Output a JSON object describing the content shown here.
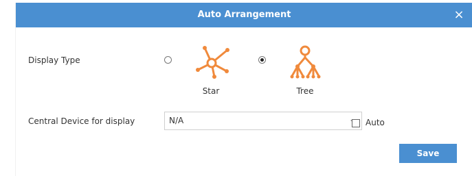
{
  "dialog": {
    "title": "Auto Arrangement",
    "close_icon": "close-icon",
    "close_glyph": "×"
  },
  "display_type": {
    "label": "Display Type",
    "options": [
      {
        "label": "Star",
        "icon": "star-topology-icon",
        "selected": false
      },
      {
        "label": "Tree",
        "icon": "tree-topology-icon",
        "selected": true
      }
    ]
  },
  "central_device": {
    "label": "Central Device for display",
    "value": "N/A",
    "auto_label": "Auto",
    "auto_checked": false
  },
  "save_label": "Save",
  "colors": {
    "title_bar": "#4a8fd1",
    "button": "#4a8fd1",
    "icon": "#f08a3c"
  }
}
